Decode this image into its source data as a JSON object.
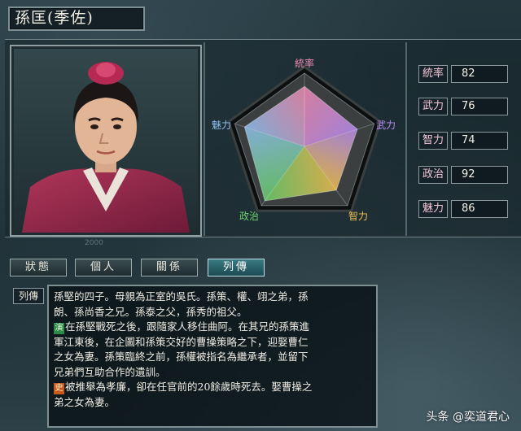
{
  "character": {
    "name": "孫匡(季佐)"
  },
  "stats_chart": {
    "axes": [
      "統率",
      "武力",
      "智力",
      "政治",
      "魅力"
    ],
    "values": [
      82,
      76,
      74,
      92,
      86
    ],
    "max": 100,
    "colors": {
      "統率": "#f08ab0",
      "武力": "#b88cf0",
      "智力": "#f0c050",
      "政治": "#6ad06a",
      "魅力": "#8fc0f0"
    }
  },
  "stats": [
    {
      "label": "統率",
      "value": "82"
    },
    {
      "label": "武力",
      "value": "76"
    },
    {
      "label": "智力",
      "value": "74"
    },
    {
      "label": "政治",
      "value": "92"
    },
    {
      "label": "魅力",
      "value": "86"
    }
  ],
  "tabs": [
    {
      "label": "狀態"
    },
    {
      "label": "個人"
    },
    {
      "label": "關係"
    },
    {
      "label": "列傳",
      "active": true
    }
  ],
  "bio": {
    "section_label": "列傳",
    "icons": {
      "yan": "演",
      "shi": "史"
    },
    "lines": [
      "孫堅的四子。母親為正室的吳氏。孫策、權、翊之弟，孫",
      "朗、孫尚香之兄。孫泰之父，孫秀的祖父。",
      "在孫堅戰死之後，跟隨家人移住曲阿。在其兄的孫策進",
      "軍江東後，在企圖和孫策交好的曹操策略之下，迎娶曹仁",
      "之女為妻。孫策臨終之前，孫權被指名為繼承者，並留下",
      "兄弟們互助合作的遺訓。",
      "被推舉為孝廉，卻在任官前的20餘歲時死去。娶曹操之",
      "弟之女為妻。"
    ]
  },
  "year_mark": "2000",
  "watermark": "头条 @奕道君心"
}
